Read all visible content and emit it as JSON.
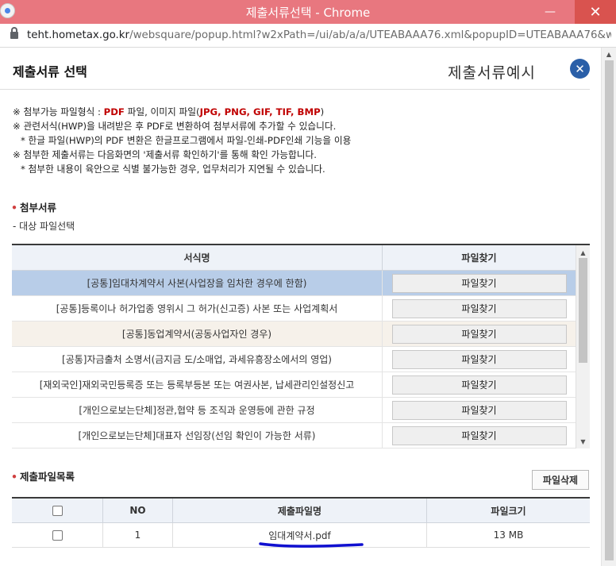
{
  "window": {
    "title": "제출서류선택 - Chrome",
    "minimize_glyph": "—",
    "close_glyph": "✕"
  },
  "address": {
    "host": "teht.hometax.go.kr",
    "path": "/websquare/popup.html?w2xPath=/ui/ab/a/a/UTEABAAA76.xml&popupID=UTEABAAA76&w2..."
  },
  "header": {
    "title": "제출서류 선택",
    "example_title": "제출서류예시",
    "close_glyph": "✕"
  },
  "notes": {
    "line1": {
      "prefix": "※ 첨부가능 파일형식 : ",
      "pdf": "PDF",
      "mid": " 파일, 이미지 파일(",
      "formats": "JPG, PNG, GIF, TIF, BMP",
      "suffix": ")"
    },
    "line2": "※ 관련서식(HWP)을 내려받은 후 PDF로 변환하여 첨부서류에 추가할 수 있습니다.",
    "line3": "* 한글 파일(HWP)의 PDF 변환은 한글프로그램에서 파일-인쇄-PDF인쇄 기능을 이용",
    "line4": "※ 첨부한 제출서류는 다음화면의 '제출서류 확인하기'를 통해 확인 가능합니다.",
    "line5": "* 첨부한 내용이 육안으로 식별 불가능한 경우, 업무처리가 지연될 수 있습니다."
  },
  "attach_section": {
    "title": "첨부서류",
    "sub_label": "- 대상 파일선택",
    "col_form": "서식명",
    "col_find": "파일찾기",
    "find_label": "파일찾기",
    "rows": [
      {
        "name": "[공통]임대차계약서 사본(사업장을 임차한 경우에 한함)"
      },
      {
        "name": "[공통]등록이나 허가업종 영위시 그 허가(신고증) 사본 또는 사업계획서"
      },
      {
        "name": "[공통]동업계약서(공동사업자인 경우)"
      },
      {
        "name": "[공통]자금출처 소명서(금지금 도/소매업, 과세유흥장소에서의 영업)"
      },
      {
        "name": "[재외국인]재외국민등록증 또는 등록부등본 또는 여권사본, 납세관리인설정신고"
      },
      {
        "name": "[개인으로보는단체]정관,협약 등 조직과 운영등에 관한 규정"
      },
      {
        "name": "[개인으로보는단체]대표자 선임장(선임 확인이 가능한 서류)"
      }
    ]
  },
  "submit_section": {
    "title": "제출파일목록",
    "delete_label": "파일삭제",
    "col_no": "NO",
    "col_name": "제출파일명",
    "col_size": "파일크기",
    "files": [
      {
        "no": "1",
        "name": "임대계약서.pdf",
        "size": "13 MB"
      }
    ]
  },
  "colors": {
    "titlebar": "#e8777f",
    "accent_blue": "#2a5fa8",
    "selected_row": "#b8cde8",
    "highlight_red": "#c00000",
    "underline_mark": "#1010d0"
  }
}
